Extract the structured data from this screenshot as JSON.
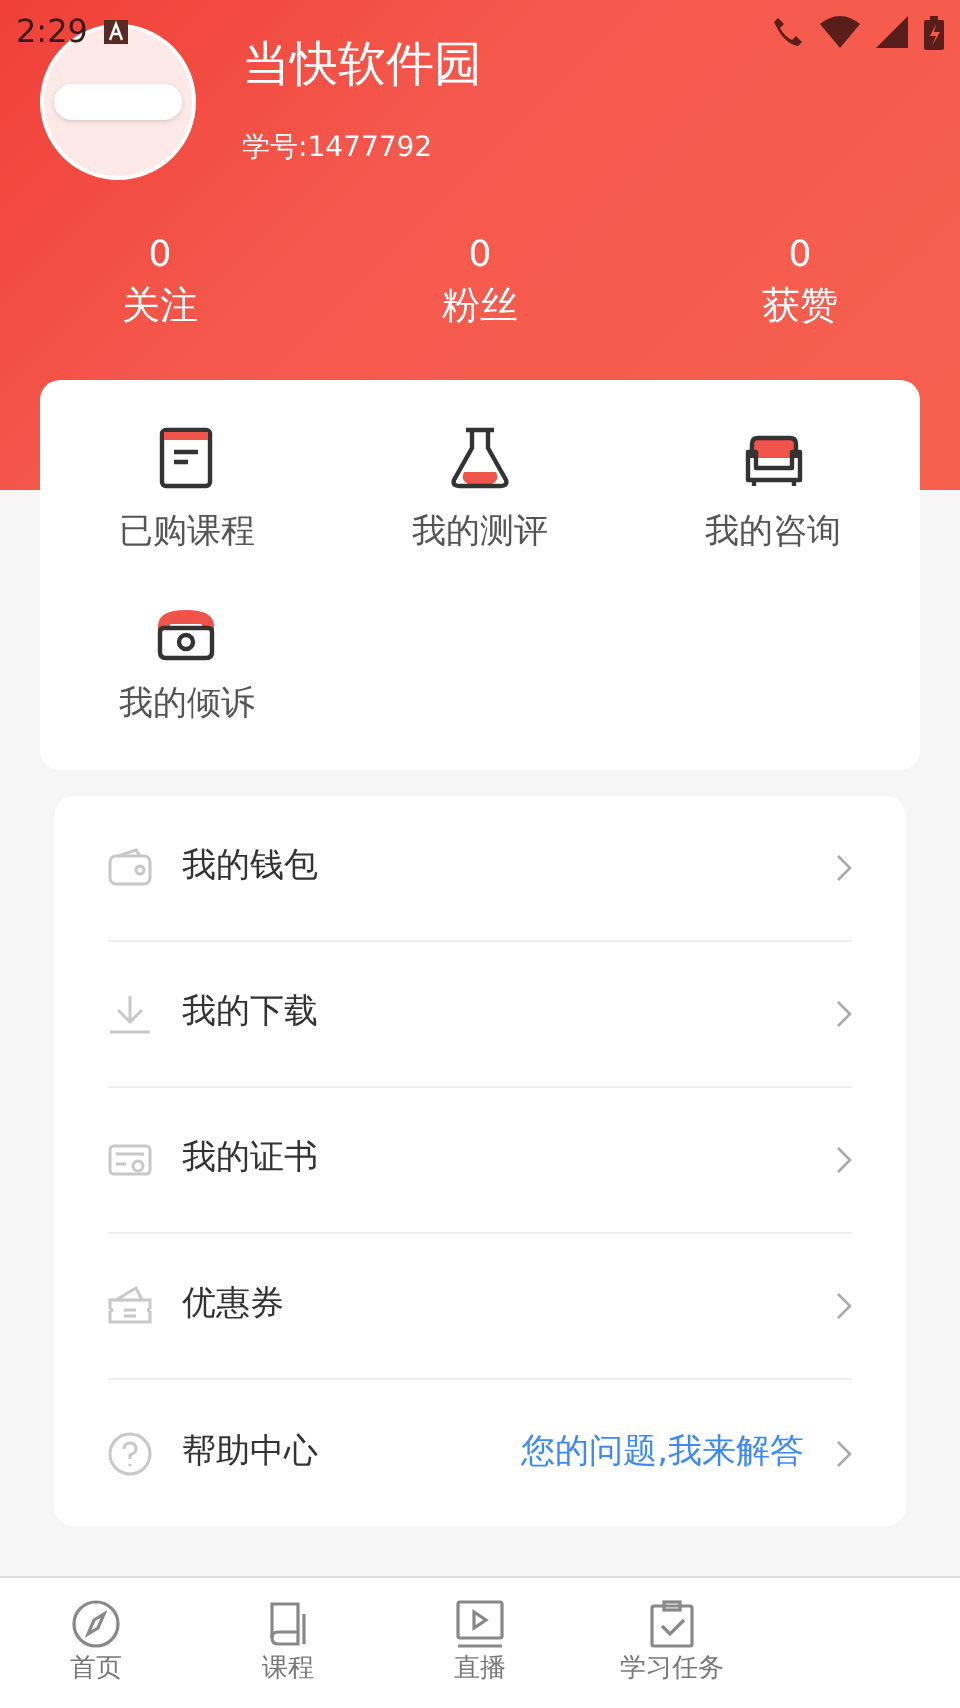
{
  "status_bar": {
    "time": "2:29"
  },
  "profile": {
    "name": "当快软件园",
    "student_id": "学号:1477792"
  },
  "stats": [
    {
      "value": "0",
      "label": "关注"
    },
    {
      "value": "0",
      "label": "粉丝"
    },
    {
      "value": "0",
      "label": "获赞"
    }
  ],
  "shortcuts": [
    {
      "kind": "book",
      "label": "已购课程"
    },
    {
      "kind": "flask",
      "label": "我的测评"
    },
    {
      "kind": "sofa",
      "label": "我的咨询"
    },
    {
      "kind": "phone",
      "label": "我的倾诉"
    }
  ],
  "menu": [
    {
      "kind": "wallet",
      "label": "我的钱包"
    },
    {
      "kind": "download",
      "label": "我的下载"
    },
    {
      "kind": "certificate",
      "label": "我的证书"
    },
    {
      "kind": "coupon",
      "label": "优惠券"
    },
    {
      "kind": "help",
      "label": "帮助中心",
      "hint": "您的问题,我来解答"
    }
  ],
  "bottom_nav": [
    {
      "kind": "compass",
      "label": "首页"
    },
    {
      "kind": "book",
      "label": "课程"
    },
    {
      "kind": "play",
      "label": "直播"
    },
    {
      "kind": "clipboard",
      "label": "学习任务"
    }
  ]
}
